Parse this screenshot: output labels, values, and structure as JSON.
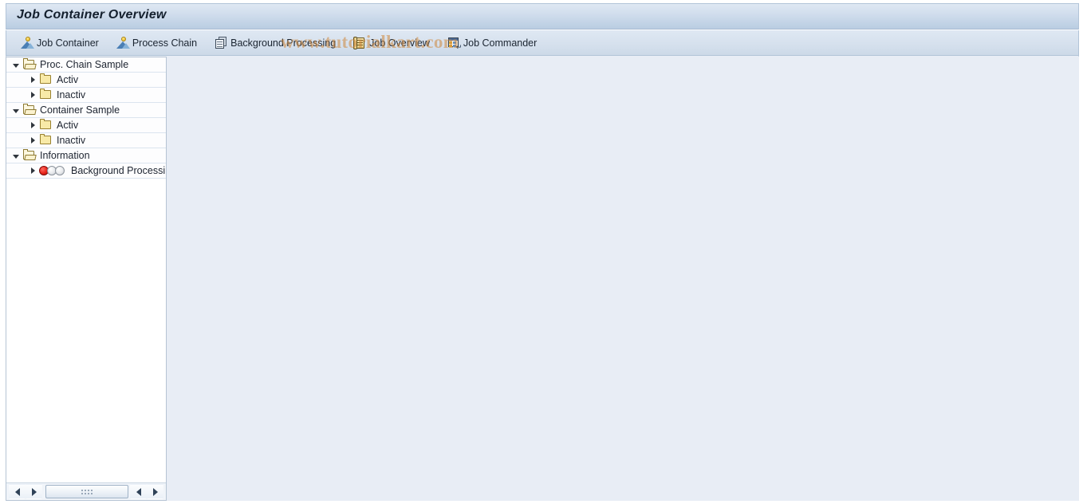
{
  "window": {
    "title": "Job Container Overview"
  },
  "watermark": {
    "text": "www.tutorialkart.com",
    "color": "#ce863a"
  },
  "toolbar": {
    "items": [
      {
        "label": "Job Container",
        "icon": "person-mountain-icon"
      },
      {
        "label": "Process Chain",
        "icon": "person-mountain-icon"
      },
      {
        "label": "Background Processing",
        "icon": "document-stack-icon"
      },
      {
        "label": "Job Overview",
        "icon": "scroll-list-icon"
      },
      {
        "label": "Job Commander",
        "icon": "grid-table-icon"
      }
    ]
  },
  "tree": {
    "rows": [
      {
        "label": "Proc. Chain Sample",
        "level": 0,
        "twisty": "down",
        "icon": "folder-open-icon"
      },
      {
        "label": "Activ",
        "level": 1,
        "twisty": "right",
        "icon": "folder-closed-icon"
      },
      {
        "label": "Inactiv",
        "level": 1,
        "twisty": "right",
        "icon": "folder-closed-icon"
      },
      {
        "label": "Container Sample",
        "level": 0,
        "twisty": "down",
        "icon": "folder-open-icon"
      },
      {
        "label": "Activ",
        "level": 1,
        "twisty": "right",
        "icon": "folder-closed-icon"
      },
      {
        "label": "Inactiv",
        "level": 1,
        "twisty": "right",
        "icon": "folder-closed-icon"
      },
      {
        "label": "Information",
        "level": 0,
        "twisty": "down",
        "icon": "folder-open-icon"
      },
      {
        "label": "Background Processing",
        "level": 1,
        "twisty": "right",
        "icon": "traffic-light-red-icon"
      }
    ]
  },
  "scrollbar": {
    "left_arrow": "◀",
    "right_arrow": "▶"
  },
  "colors": {
    "title_bar_top": "#dfe8f3",
    "title_bar_bottom": "#b9cde2",
    "workarea_bg": "#e8edf5",
    "tree_bg": "#ffffff",
    "row_separator": "#dbe4ef",
    "status_red": "#e8251b"
  }
}
